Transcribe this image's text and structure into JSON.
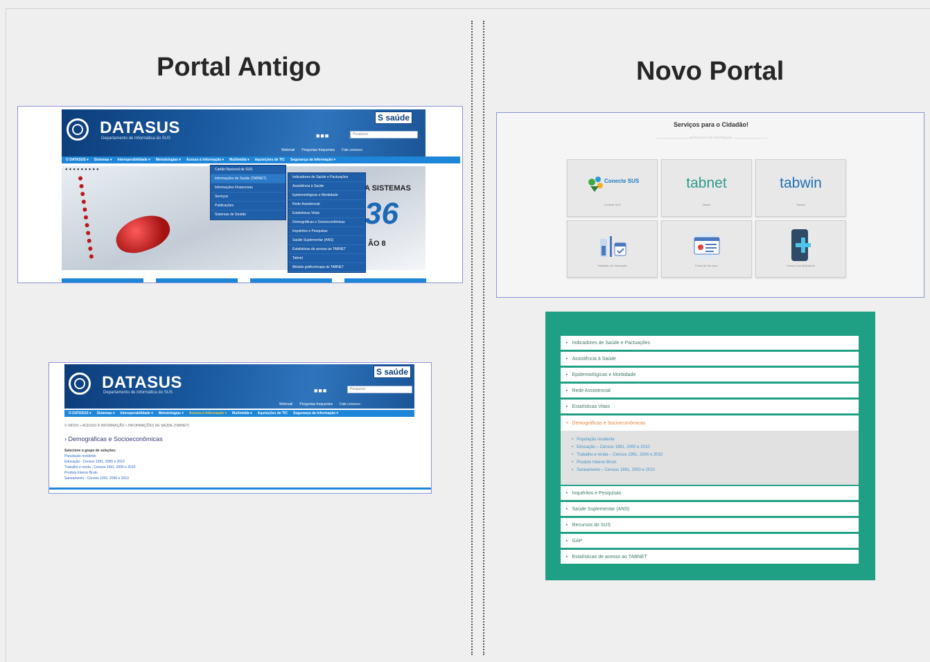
{
  "left_heading": "Portal Antigo",
  "right_heading": "Novo Portal",
  "old_portal": {
    "brand": "DATASUS",
    "brand_sub": "Departamento de Informática do SUS",
    "saude_badge": "S saúde",
    "search_placeholder": "Pesquisar",
    "top_links": [
      "Webmail",
      "Perguntas frequentes",
      "Fale conosco"
    ],
    "nav_items": [
      "O DATASUS ▾",
      "Sistemas ▾",
      "Interoperabilidade ▾",
      "Metodologias ▾",
      "Acesso à Informação ▾",
      "Multimídia ▾",
      "Aquisições de TIC",
      "Segurança da Informação ▾"
    ],
    "dropdown_level1": [
      "Cartão Nacional de SUS",
      "Informações de Saúde (TABNET)",
      "Informações Financeiras",
      "Serviços",
      "Publicações",
      "Sistemas de Gestão"
    ],
    "dropdown_level2": [
      "Indicadores de Saúde e Pactuações",
      "Assistência à Saúde",
      "Epidemiológicas e Morbidade",
      "Rede Assistencial",
      "Estatísticas Vitais",
      "Demográficas e Socioeconômicas",
      "Inquéritos e Pesquisas",
      "Saúde Suplementar (ANS)",
      "Estatísticas de acesso ao TABNET",
      "Tabnet",
      "Módulo gráfico/mapa do TABNET"
    ],
    "hero_text": "A SISTEMAS",
    "hero_number": "36",
    "hero_text2": "ÃO 8",
    "breadcrumb": "⚲ INÍCIO » ACESSO À INFORMAÇÃO » INFORMAÇÕES DE SAÚDE (TABNET)",
    "page_heading": "Demográficas e Socioeconômicas",
    "selection_label": "Selecione o grupo de seleções:",
    "selection_links": [
      "População residente",
      "Educação - Censos 1991, 2000 e 2010",
      "Trabalho e renda - Censos 1991, 2000 e 2010",
      "Produto Interno Bruto",
      "Saneamento - Censos 1991, 2000 e 2010"
    ]
  },
  "new_portal": {
    "services_title": "Serviços para o Cidadão!",
    "services_sub": "SERVIÇOS EM DESTAQUE",
    "cards": [
      {
        "logo": "Conecte SUS",
        "caption": "Conecte SUS",
        "icon": "conecte-sus-logo"
      },
      {
        "logo": "tabnet",
        "caption": "Tabnet",
        "icon": "tabnet-logo"
      },
      {
        "logo": "tabwin",
        "caption": "Tabwin",
        "icon": "tabwin-logo"
      },
      {
        "logo": "",
        "caption": "Validação de Vacinação",
        "icon": "vaccine-icon"
      },
      {
        "logo": "",
        "caption": "Portal de Serviços",
        "icon": "browser-icon"
      },
      {
        "logo": "",
        "caption": "Acesso aos Aplicativos",
        "icon": "mobile-plus-icon"
      }
    ],
    "accordion_top": [
      "Indicadores de Saúde e Pactuações",
      "Assistência à Saúde",
      "Epidemiológicas e Morbidade",
      "Rede Assistencial",
      "Estatísticas Vitais"
    ],
    "accordion_open": "Demográficas e Socioeconômicas",
    "accordion_open_items": [
      "População residente",
      "Educação – Censos 1991, 2000 e 2010",
      "Trabalho e renda – Censos 1991, 2000 e 2010",
      "Produto Interno Bruto",
      "Saneamento – Censos 1991, 2000 e 2010"
    ],
    "accordion_bottom": [
      "Inquéritos e Pesquisas",
      "Saúde Suplementar (ANS)",
      "Recursos do SUS",
      "GAP",
      "Estatísticas de acesso ao TABNET"
    ]
  }
}
